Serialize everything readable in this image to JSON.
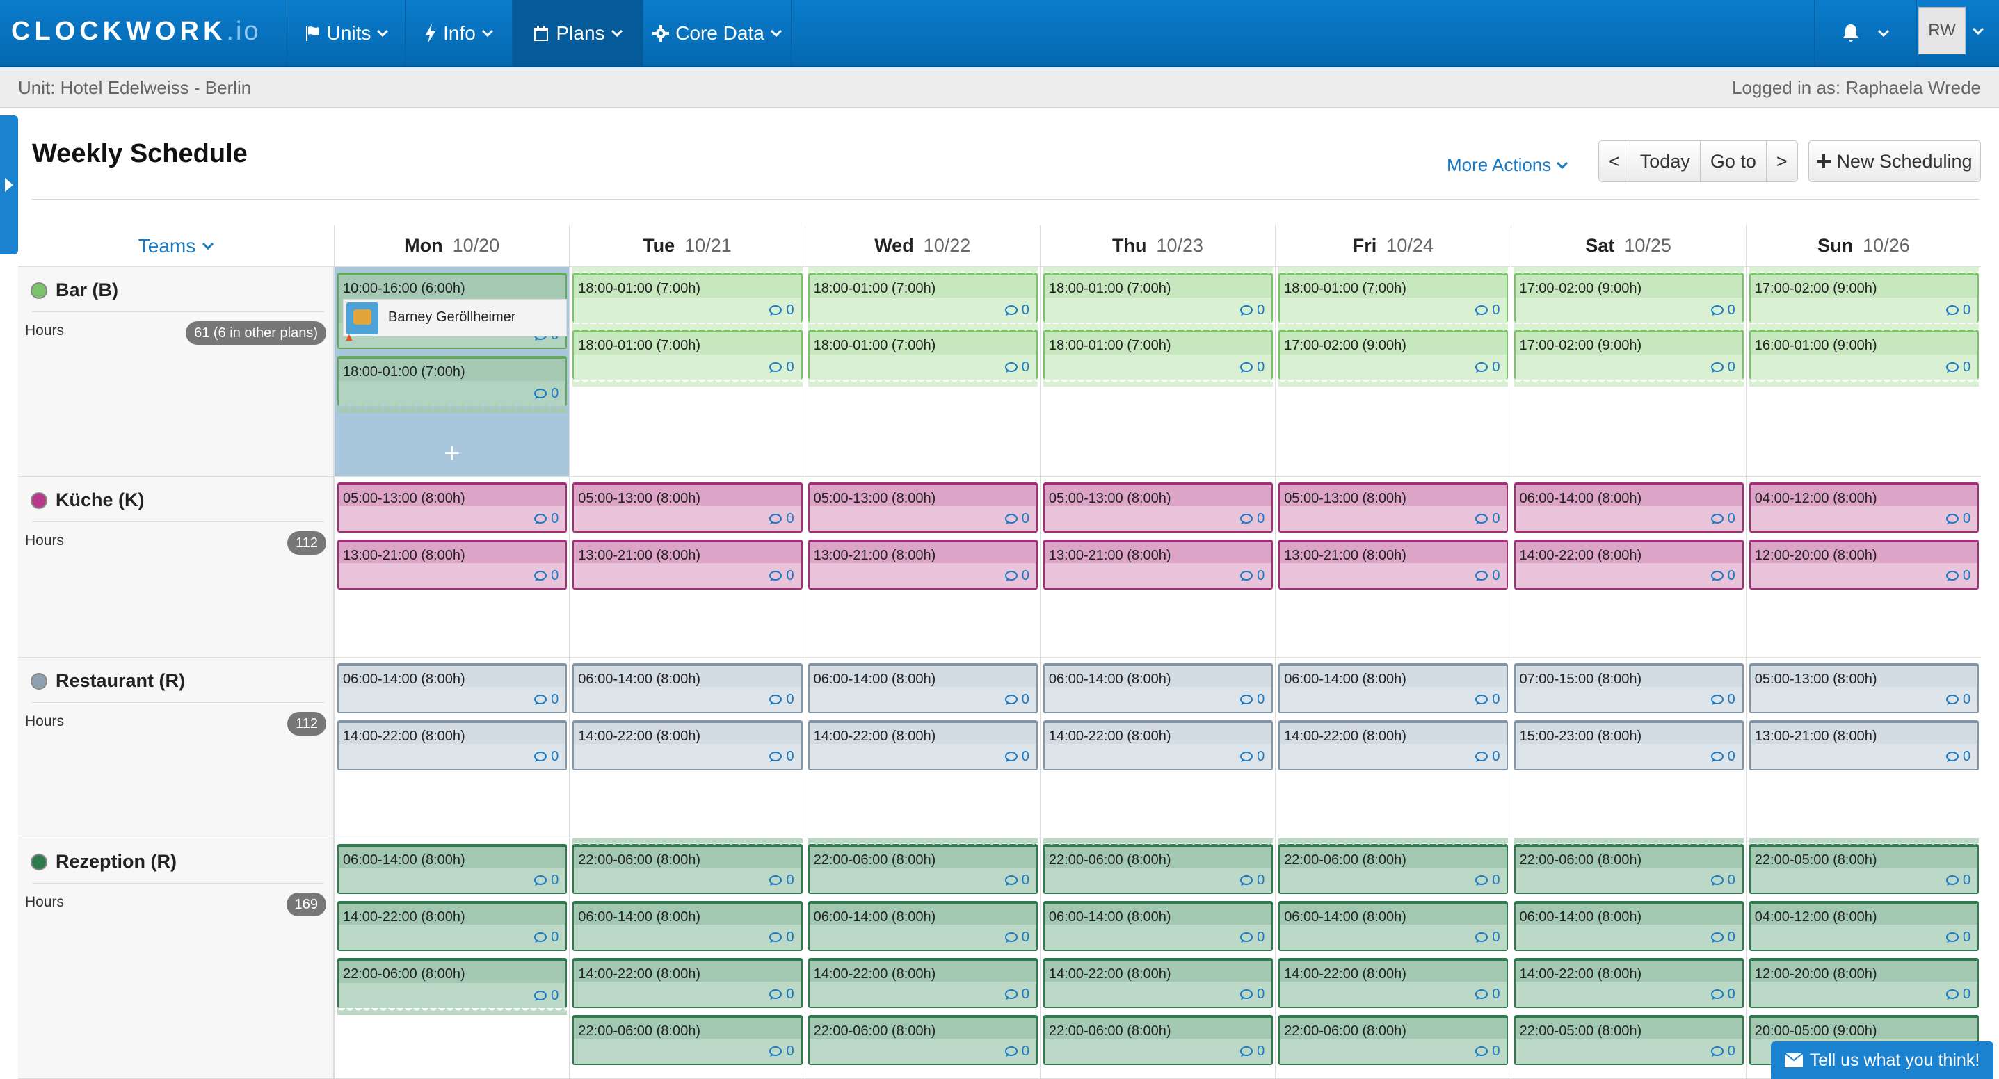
{
  "brand": {
    "name": "CLOCKWORK",
    "suffix": ".io"
  },
  "nav": {
    "items": [
      {
        "label": "Units",
        "icon": "flag-icon"
      },
      {
        "label": "Info",
        "icon": "bolt-icon"
      },
      {
        "label": "Plans",
        "icon": "calendar-icon"
      },
      {
        "label": "Core Data",
        "icon": "gear-icon"
      }
    ],
    "avatar": "RW"
  },
  "subbar": {
    "unit": "Unit: Hotel Edelweiss - Berlin",
    "login": "Logged in as: Raphaela Wrede"
  },
  "header": {
    "title": "Weekly Schedule",
    "more_actions": "More Actions",
    "prev": "<",
    "today": "Today",
    "goto": "Go to",
    "next": ">",
    "new_scheduling": "New Scheduling"
  },
  "grid": {
    "teams_label": "Teams",
    "days": [
      {
        "name": "Mon",
        "date": "10/20"
      },
      {
        "name": "Tue",
        "date": "10/21"
      },
      {
        "name": "Wed",
        "date": "10/22"
      },
      {
        "name": "Thu",
        "date": "10/23"
      },
      {
        "name": "Fri",
        "date": "10/24"
      },
      {
        "name": "Sat",
        "date": "10/25"
      },
      {
        "name": "Sun",
        "date": "10/26"
      }
    ],
    "teams": [
      {
        "name": "Bar (B)",
        "hours_label": "Hours",
        "hours": "61 (6 in other plans)",
        "color": "#7bc26b",
        "style": "t-bar",
        "days": [
          [
            "10:00-16:00 (6:00h)",
            "18:00-01:00 (7:00h)"
          ],
          [
            "18:00-01:00 (7:00h)",
            "18:00-01:00 (7:00h)"
          ],
          [
            "18:00-01:00 (7:00h)",
            "18:00-01:00 (7:00h)"
          ],
          [
            "18:00-01:00 (7:00h)",
            "18:00-01:00 (7:00h)"
          ],
          [
            "18:00-01:00 (7:00h)",
            "17:00-02:00 (9:00h)"
          ],
          [
            "17:00-02:00 (9:00h)",
            "17:00-02:00 (9:00h)"
          ],
          [
            "17:00-02:00 (9:00h)",
            "16:00-01:00 (9:00h)"
          ]
        ]
      },
      {
        "name": "Küche (K)",
        "hours_label": "Hours",
        "hours": "112",
        "color": "#b8388a",
        "style": "t-kue",
        "days": [
          [
            "05:00-13:00 (8:00h)",
            "13:00-21:00 (8:00h)"
          ],
          [
            "05:00-13:00 (8:00h)",
            "13:00-21:00 (8:00h)"
          ],
          [
            "05:00-13:00 (8:00h)",
            "13:00-21:00 (8:00h)"
          ],
          [
            "05:00-13:00 (8:00h)",
            "13:00-21:00 (8:00h)"
          ],
          [
            "05:00-13:00 (8:00h)",
            "13:00-21:00 (8:00h)"
          ],
          [
            "06:00-14:00 (8:00h)",
            "14:00-22:00 (8:00h)"
          ],
          [
            "04:00-12:00 (8:00h)",
            "12:00-20:00 (8:00h)"
          ]
        ]
      },
      {
        "name": "Restaurant (R)",
        "hours_label": "Hours",
        "hours": "112",
        "color": "#8fa0b0",
        "style": "t-res",
        "days": [
          [
            "06:00-14:00 (8:00h)",
            "14:00-22:00 (8:00h)"
          ],
          [
            "06:00-14:00 (8:00h)",
            "14:00-22:00 (8:00h)"
          ],
          [
            "06:00-14:00 (8:00h)",
            "14:00-22:00 (8:00h)"
          ],
          [
            "06:00-14:00 (8:00h)",
            "14:00-22:00 (8:00h)"
          ],
          [
            "06:00-14:00 (8:00h)",
            "14:00-22:00 (8:00h)"
          ],
          [
            "07:00-15:00 (8:00h)",
            "15:00-23:00 (8:00h)"
          ],
          [
            "05:00-13:00 (8:00h)",
            "13:00-21:00 (8:00h)"
          ]
        ]
      },
      {
        "name": "Rezeption (R)",
        "hours_label": "Hours",
        "hours": "169",
        "color": "#2f7b4e",
        "style": "t-rez",
        "days": [
          [
            "06:00-14:00 (8:00h)",
            "14:00-22:00 (8:00h)",
            "22:00-06:00 (8:00h)"
          ],
          [
            "22:00-06:00 (8:00h)",
            "06:00-14:00 (8:00h)",
            "14:00-22:00 (8:00h)",
            "22:00-06:00 (8:00h)"
          ],
          [
            "22:00-06:00 (8:00h)",
            "06:00-14:00 (8:00h)",
            "14:00-22:00 (8:00h)",
            "22:00-06:00 (8:00h)"
          ],
          [
            "22:00-06:00 (8:00h)",
            "06:00-14:00 (8:00h)",
            "14:00-22:00 (8:00h)",
            "22:00-06:00 (8:00h)"
          ],
          [
            "22:00-06:00 (8:00h)",
            "06:00-14:00 (8:00h)",
            "14:00-22:00 (8:00h)",
            "22:00-06:00 (8:00h)"
          ],
          [
            "22:00-06:00 (8:00h)",
            "06:00-14:00 (8:00h)",
            "14:00-22:00 (8:00h)",
            "22:00-05:00 (8:00h)"
          ],
          [
            "22:00-05:00 (8:00h)",
            "04:00-12:00 (8:00h)",
            "12:00-20:00 (8:00h)",
            "20:00-05:00 (9:00h)"
          ]
        ]
      }
    ],
    "comment_count": "0",
    "assigned_employee": "Barney Geröllheimer",
    "add_symbol": "+"
  },
  "feedback": {
    "label": "Tell us what you think!"
  }
}
